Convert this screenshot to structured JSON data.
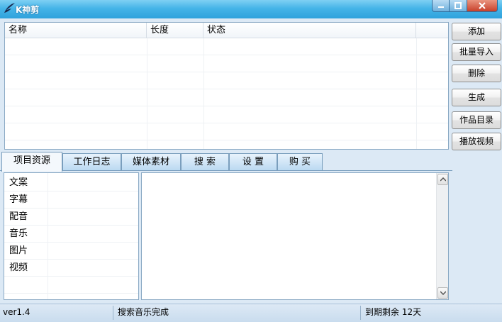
{
  "window": {
    "title": "K神剪",
    "logo_icon": "feather-logo-icon",
    "controls": [
      "minimize-icon",
      "maximize-icon",
      "close-icon"
    ]
  },
  "file_list": {
    "columns": [
      "名称",
      "长度",
      "状态"
    ],
    "rows": []
  },
  "buttons": {
    "add": "添加",
    "batch_import": "批量导入",
    "delete": "删除",
    "generate": "生成",
    "works_dir": "作品目录",
    "play_video": "播放视频"
  },
  "tabs": {
    "items": [
      "项目资源",
      "工作日志",
      "媒体素材",
      "搜 索",
      "设 置",
      "购 买"
    ],
    "active": "项目资源"
  },
  "resources": {
    "items": [
      "文案",
      "字幕",
      "配音",
      "音乐",
      "图片",
      "视频"
    ]
  },
  "content": {
    "text": ""
  },
  "status": {
    "version": "ver1.4",
    "message": "搜索音乐完成",
    "expiry": "到期剩余 12天"
  },
  "colors": {
    "titlebar": "#45b4e8",
    "background": "#dce9f5",
    "close_button": "#c8402a"
  }
}
